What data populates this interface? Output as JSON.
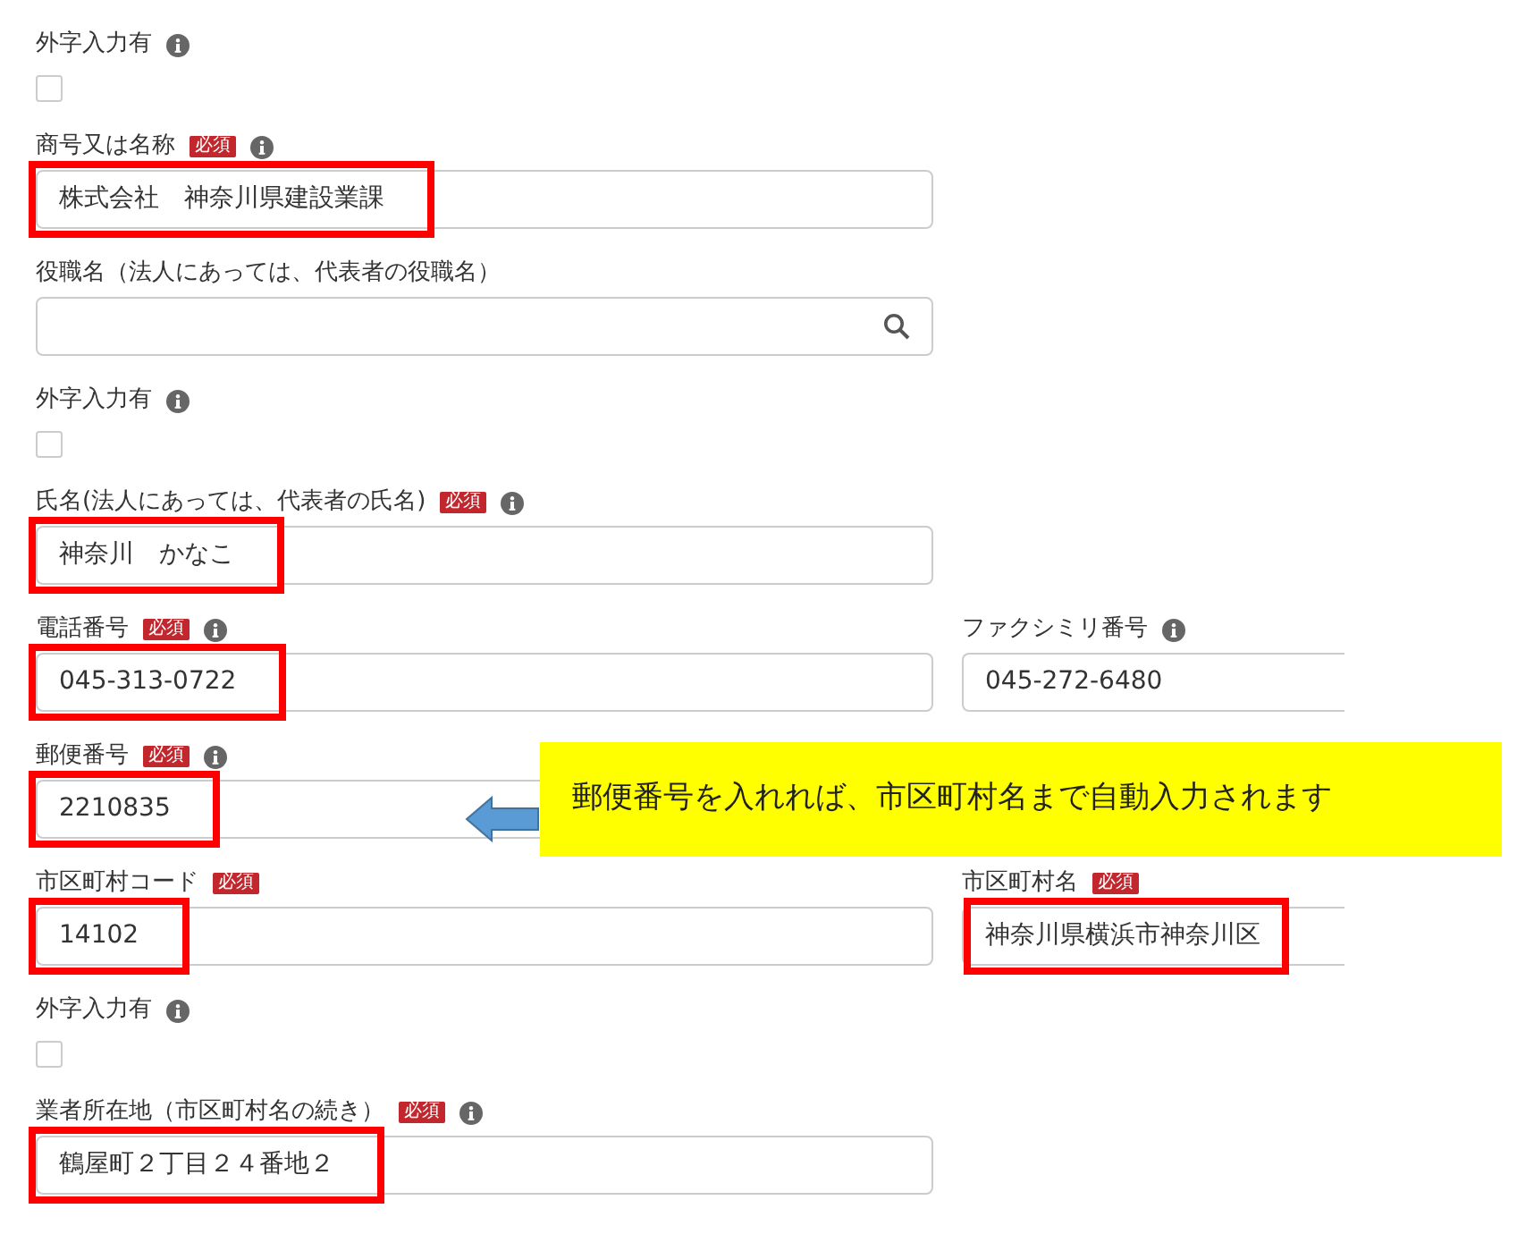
{
  "rows": [
    {
      "fields": [
        {
          "kind": "checkbox",
          "label": "外字入力有",
          "info": true,
          "checked": false
        }
      ]
    },
    {
      "fields": [
        {
          "kind": "text",
          "label": "商号又は名称",
          "badge": "必須",
          "info": true,
          "value": "株式会社　神奈川県建設業課",
          "highlighted": true
        }
      ]
    },
    {
      "fields": [
        {
          "kind": "search",
          "label": "役職名（法人にあっては、代表者の役職名）",
          "info": false,
          "highlighted": false
        }
      ]
    },
    {
      "fields": [
        {
          "kind": "checkbox",
          "label": "外字入力有",
          "info": true,
          "checked": false
        }
      ]
    },
    {
      "fields": [
        {
          "kind": "text",
          "label": "氏名(法人にあっては、代表者の氏名)",
          "badge": "必須",
          "info": true,
          "value": "神奈川　かなこ",
          "highlighted": true
        }
      ]
    },
    {
      "fields": [
        {
          "kind": "text",
          "label": "電話番号",
          "badge": "必須",
          "info": true,
          "value": "045-313-0722",
          "highlighted": true
        },
        {
          "kind": "text",
          "label": "ファクシミリ番号",
          "info": true,
          "value": "045-272-6480",
          "highlighted": false
        }
      ]
    },
    {
      "fields": [
        {
          "kind": "text",
          "label": "郵便番号",
          "badge": "必須",
          "info": true,
          "value": "2210835",
          "highlighted": true
        }
      ],
      "callout": "郵便番号を入れれば、市区町村名まで自動入力されます"
    },
    {
      "fields": [
        {
          "kind": "text",
          "label": "市区町村コード",
          "badge": "必須",
          "info": false,
          "value": "14102",
          "highlighted": true
        },
        {
          "kind": "text",
          "label": "市区町村名",
          "badge": "必須",
          "info": false,
          "value": "神奈川県横浜市神奈川区",
          "highlighted": true
        }
      ]
    },
    {
      "fields": [
        {
          "kind": "checkbox",
          "label": "外字入力有",
          "info": true,
          "checked": false
        }
      ]
    },
    {
      "fields": [
        {
          "kind": "text",
          "label": "業者所在地（市区町村名の続き）",
          "badge": "必須",
          "info": true,
          "value": "鶴屋町２丁目２４番地２",
          "highlighted": true
        }
      ]
    }
  ]
}
